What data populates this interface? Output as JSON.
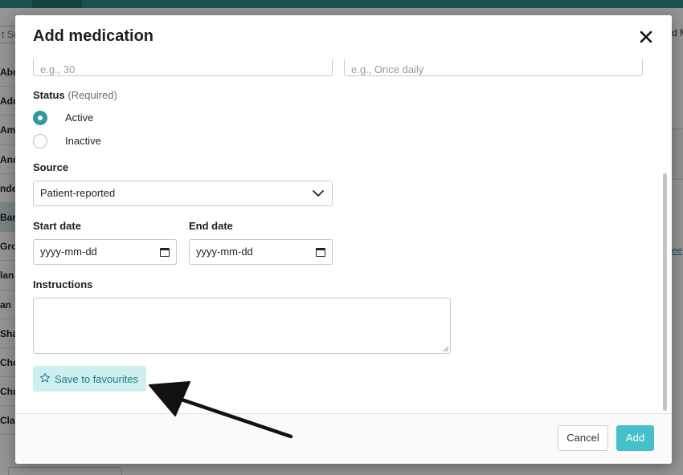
{
  "background": {
    "search_text": "t Se",
    "header_right_text": "d M",
    "list_rows": [
      "Abra",
      "Add",
      "Aml",
      "And",
      "nde",
      "Bar",
      "Grov",
      "lan",
      "an",
      "Shar",
      "Chov",
      "Chu",
      "Clai"
    ],
    "right_link_text": "ee"
  },
  "modal": {
    "title": "Add medication",
    "fields": {
      "dose_placeholder": "e.g., 30",
      "frequency_placeholder": "e.g., Once daily"
    },
    "status": {
      "label": "Status",
      "required_note": "(Required)",
      "options": [
        {
          "label": "Active",
          "checked": true
        },
        {
          "label": "Inactive",
          "checked": false
        }
      ]
    },
    "source": {
      "label": "Source",
      "selected": "Patient-reported"
    },
    "start_date": {
      "label": "Start date",
      "placeholder": "yyyy-mm-dd"
    },
    "end_date": {
      "label": "End date",
      "placeholder": "yyyy-mm-dd"
    },
    "instructions": {
      "label": "Instructions"
    },
    "favourites_button": "Save to favourites",
    "footer": {
      "cancel_label": "Cancel",
      "add_label": "Add"
    }
  },
  "colors": {
    "accent": "#45c1cc",
    "radio_checked": "#2f9aa0",
    "favourites_bg": "#cdeff0"
  }
}
